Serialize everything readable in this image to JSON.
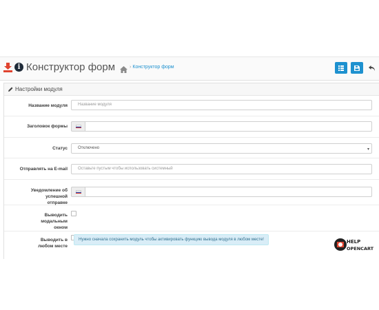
{
  "header": {
    "title": "Конструктор форм",
    "breadcrumb_sep": "›",
    "breadcrumb": "Конструктор форм",
    "icons": [
      "download-icon",
      "info-icon",
      "home-icon"
    ],
    "buttons": [
      "list-icon",
      "save-icon",
      "back-icon"
    ],
    "accent_color": "#1e91cf"
  },
  "panel": {
    "title": "Настройки модуля",
    "icon": "pencil-icon"
  },
  "form": {
    "name": {
      "label": "Название модуля",
      "placeholder": "Название модуля",
      "value": ""
    },
    "form_title": {
      "label": "Заголовок формы",
      "value": ""
    },
    "status": {
      "label": "Статус",
      "value": "Отключено"
    },
    "email": {
      "label": "Отправлять на E-mail",
      "placeholder": "Оставьте пустым чтобы использовать системный",
      "value": ""
    },
    "success": {
      "label": "Уведомление об успешной отправке",
      "value": ""
    },
    "modal": {
      "label": "Выводить модальным окном",
      "checked": false
    },
    "anywhere": {
      "label": "Выводить в любом месте",
      "checked": false
    }
  },
  "alert": "Нужно сначала сохранить модуль чтобы активировать функцию вывода модуля в любом месте!",
  "logo": {
    "line1": "HELP",
    "line2": "OPENCART"
  }
}
